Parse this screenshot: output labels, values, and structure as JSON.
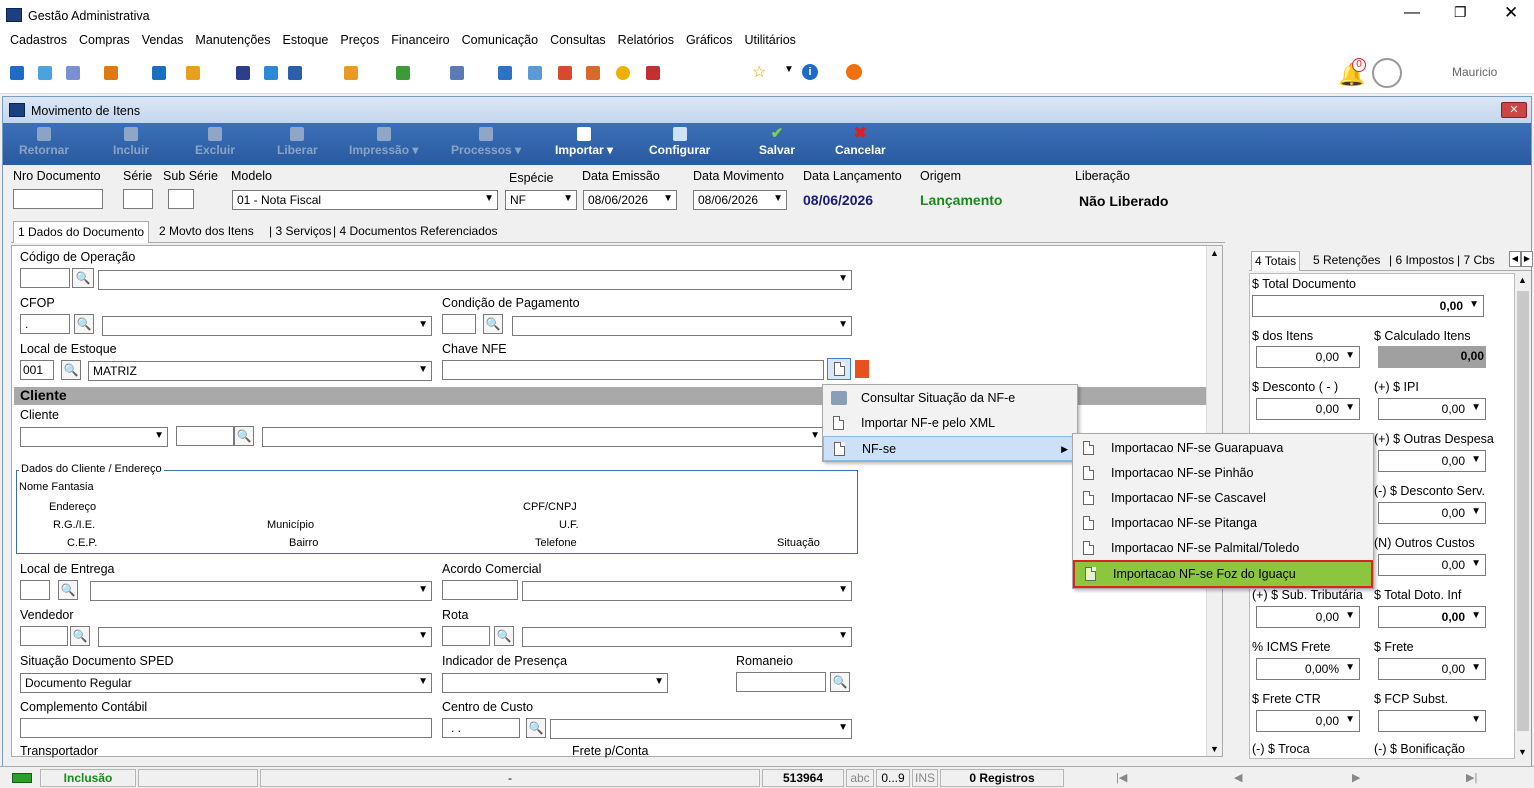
{
  "app": {
    "title": "Gestão Administrativa",
    "user": "Mauricio",
    "notif_count": "0"
  },
  "menu": [
    "Cadastros",
    "Compras",
    "Vendas",
    "Manutenções",
    "Estoque",
    "Preços",
    "Financeiro",
    "Comunicação",
    "Consultas",
    "Relatórios",
    "Gráficos",
    "Utilitários"
  ],
  "child": {
    "title": "Movimento de Itens"
  },
  "ribbon": {
    "retornar": "Retornar",
    "incluir": "Incluir",
    "excluir": "Excluir",
    "liberar": "Liberar",
    "impressao": "Impressão",
    "processos": "Processos",
    "importar": "Importar",
    "configurar": "Configurar",
    "salvar": "Salvar",
    "cancelar": "Cancelar"
  },
  "header": {
    "nro_documento": "Nro Documento",
    "serie": "Série",
    "sub_serie": "Sub Série",
    "modelo": "Modelo",
    "modelo_value": "01 - Nota Fiscal",
    "especie": "Espécie",
    "especie_value": "NF",
    "data_emissao": "Data Emissão",
    "data_emissao_value": "08/06/2026",
    "data_movimento": "Data Movimento",
    "data_movimento_value": "08/06/2026",
    "data_lancamento": "Data Lançamento",
    "data_lancamento_value": "08/06/2026",
    "origem": "Origem",
    "origem_value": "Lançamento",
    "liberacao": "Liberação",
    "liberacao_value": "Não Liberado"
  },
  "tabs": [
    "1 Dados do Documento",
    "2 Movto dos Itens",
    "3 Serviços",
    "4 Documentos Referenciados"
  ],
  "form": {
    "codigo_operacao": "Código de Operação",
    "cfop": "CFOP",
    "cfop_value": ".",
    "condicao_pagamento": "Condição de Pagamento",
    "local_estoque": "Local de Estoque",
    "local_code": "001",
    "local_name": "MATRIZ",
    "chave_nfe": "Chave NFE",
    "cliente_section": "Cliente",
    "cliente": "Cliente",
    "dados_cliente": "Dados do Cliente / Endereço",
    "nome_fantasia": "Nome Fantasia",
    "endereco": "Endereço",
    "cpf_cnpj": "CPF/CNPJ",
    "rg_ie": "R.G./I.E.",
    "municipio": "Município",
    "uf": "U.F.",
    "cep": "C.E.P.",
    "bairro": "Bairro",
    "telefone": "Telefone",
    "situacao": "Situação",
    "local_entrega": "Local de Entrega",
    "acordo_comercial": "Acordo Comercial",
    "vendedor": "Vendedor",
    "rota": "Rota",
    "situacao_sped": "Situação Documento SPED",
    "situacao_sped_value": "Documento Regular",
    "indicador_presenca": "Indicador de Presença",
    "romaneio": "Romaneio",
    "complemento_contabil": "Complemento Contábil",
    "centro_custo": "Centro de Custo",
    "centro_custo_value": ". .",
    "transportador": "Transportador",
    "frete_conta": "Frete p/Conta"
  },
  "context_menu": [
    "Consultar Situação da NF-e",
    "Importar NF-e pelo XML",
    "NF-se"
  ],
  "submenu": [
    "Importacao NF-se Guarapuava",
    "Importacao NF-se Pinhão",
    "Importacao NF-se Cascavel",
    "Importacao NF-se Pitanga",
    "Importacao NF-se Palmital/Toledo",
    "Importacao NF-se Foz do Iguaçu"
  ],
  "right_tabs": [
    "4 Totais",
    "5 Retenções",
    "6 Impostos",
    "7 Cbs"
  ],
  "totais": {
    "total_documento": "$ Total Documento",
    "total_documento_value": "0,00",
    "dos_itens": "$ dos Itens",
    "dos_itens_value": "0,00",
    "calculado_itens": "$ Calculado Itens",
    "calculado_itens_value": "0,00",
    "desconto": "$ Desconto ( - )",
    "desconto_value": "0,00",
    "ipi": "(+) $ IPI",
    "ipi_value": "0,00",
    "outras_despesas": "(+) $ Outras Despesa",
    "outras_despesas_value": "0,00",
    "desconto_serv": "(-) $ Desconto Serv.",
    "desconto_serv_value": "0,00",
    "outros_custos": "(N) Outros Custos",
    "outros_custos_value": "0,00",
    "sub_tributaria": "(+) $ Sub. Tributária",
    "sub_tributaria_value": "0,00",
    "total_doto_inf": "$ Total Doto. Inf",
    "total_doto_inf_value": "0,00",
    "icms_frete": "% ICMS Frete",
    "icms_frete_value": "0,00%",
    "frete": "$ Frete",
    "frete_value": "0,00",
    "frete_ctr": "$ Frete CTR",
    "frete_ctr_value": "0,00",
    "fcp_subst": "$ FCP Subst.",
    "troca": "(-) $ Troca",
    "bonificacao": "(-) $ Bonificação"
  },
  "status": {
    "mode": "Inclusão",
    "dash": "-",
    "number": "513964",
    "abc": "abc",
    "range": "0...9",
    "ins": "INS",
    "registros": "0 Registros"
  },
  "colors": {
    "ribbon": "#2a5aa0",
    "highlight": "#8cc63f",
    "highlight_border": "#d9261c",
    "green_text": "#1a8a1a",
    "navy_text": "#1a1a7a"
  }
}
